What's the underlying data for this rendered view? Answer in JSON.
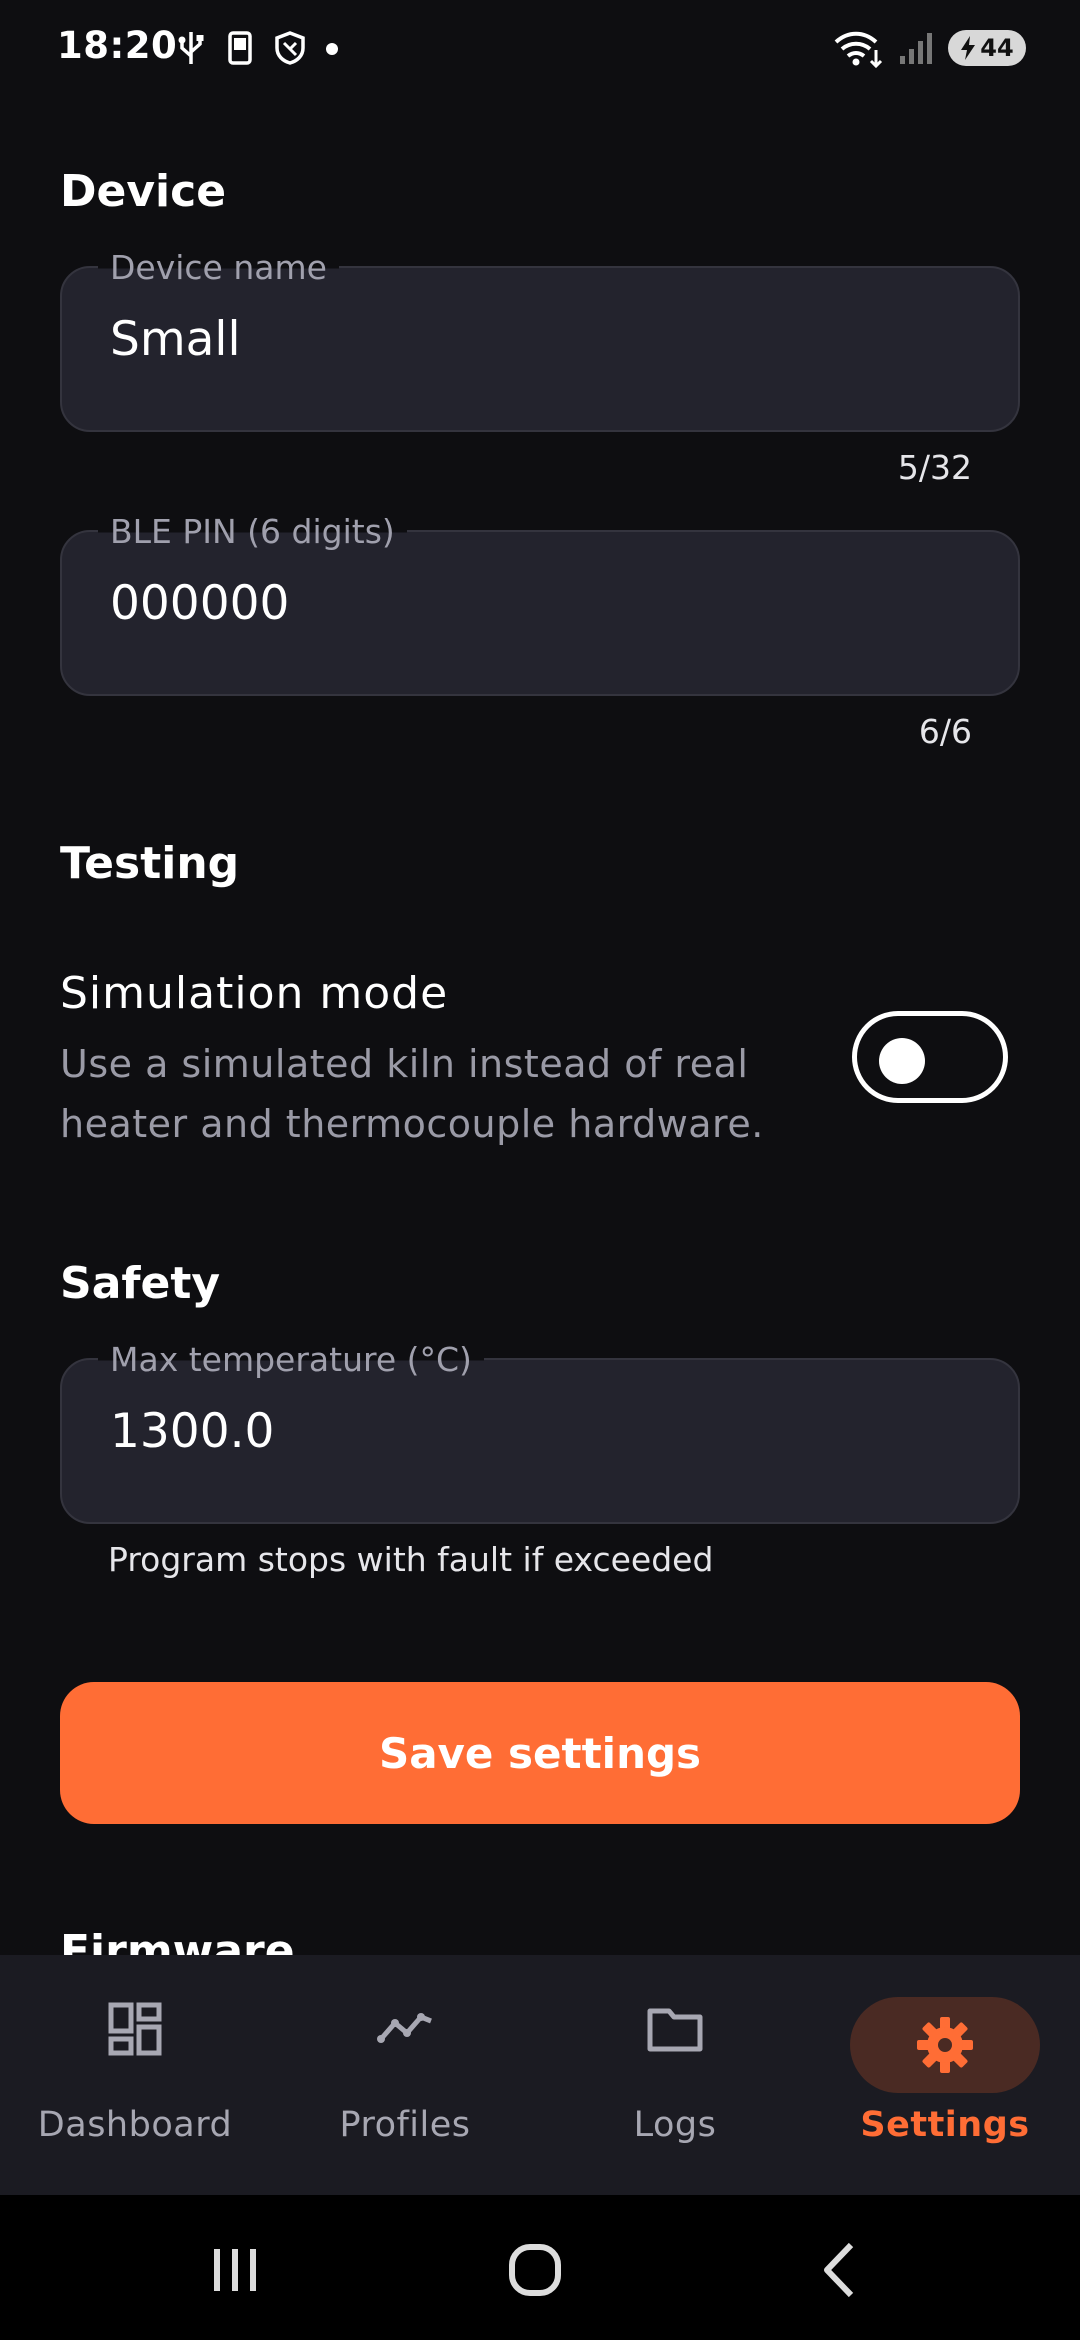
{
  "status_bar": {
    "time": "18:20",
    "battery": "44",
    "icons_left": [
      "usb-icon",
      "phone-cast-icon",
      "shield-icon",
      "dot-icon"
    ],
    "icons_right": [
      "wifi-icon",
      "signal-icon",
      "battery-icon"
    ]
  },
  "device": {
    "section_title": "Device",
    "name_label": "Device name",
    "name_value": "Small",
    "name_counter": "5/32",
    "pin_label": "BLE PIN (6 digits)",
    "pin_value": "000000",
    "pin_counter": "6/6"
  },
  "testing": {
    "section_title": "Testing",
    "simulation_title": "Simulation mode",
    "simulation_desc": "Use a simulated kiln instead of real heater and thermocouple hardware.",
    "simulation_enabled": false
  },
  "safety": {
    "section_title": "Safety",
    "max_temp_label": "Max temperature (°C)",
    "max_temp_value": "1300.0",
    "max_temp_helper": "Program stops with fault if exceeded"
  },
  "save_button": "Save settings",
  "firmware_title": "Firmware",
  "nav": {
    "items": [
      {
        "label": "Dashboard",
        "icon": "dashboard-icon"
      },
      {
        "label": "Profiles",
        "icon": "profiles-chart-icon"
      },
      {
        "label": "Logs",
        "icon": "folder-icon"
      },
      {
        "label": "Settings",
        "icon": "gear-icon"
      }
    ],
    "active": "Settings"
  },
  "colors": {
    "accent": "#ff6d35",
    "background": "#0e0e11",
    "field": "#23232d",
    "nav_bg": "#1b1b22",
    "active_pill": "#4a2a23"
  }
}
